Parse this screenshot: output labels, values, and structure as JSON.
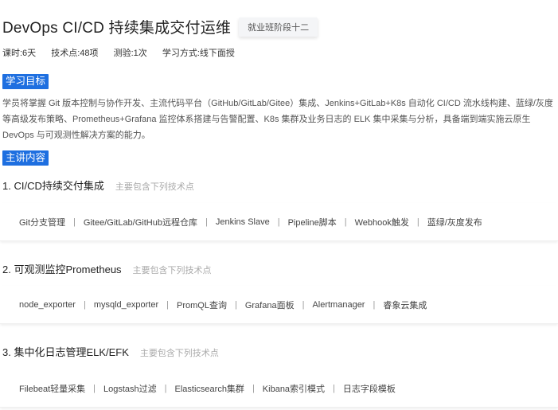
{
  "header": {
    "title": "DevOps CI/CD 持续集成交付运维",
    "stage_badge": "就业班阶段十二"
  },
  "meta": {
    "hours": "课时:6天",
    "points": "技术点:48项",
    "tests": "测验:1次",
    "mode": "学习方式:线下面授"
  },
  "goal": {
    "label": "学习目标",
    "text": "学员将掌握 Git 版本控制与协作开发、主流代码平台（GitHub/GitLab/Gitee）集成、Jenkins+GitLab+K8s 自动化 CI/CD 流水线构建、蓝绿/灰度等高级发布策略、Prometheus+Grafana 监控体系搭建与告警配置、K8s 集群及业务日志的 ELK 集中采集与分析，具备端到端实施云原生 DevOps 与可观测性解决方案的能力。"
  },
  "main": {
    "label": "主讲内容",
    "hint": "主要包含下列技术点",
    "modules": [
      {
        "title": "1. CI/CD持续交付集成",
        "points": [
          "Git分支管理",
          "Gitee/GitLab/GitHub远程仓库",
          "Jenkins Slave",
          "Pipeline脚本",
          "Webhook触发",
          "蓝绿/灰度发布"
        ]
      },
      {
        "title": "2. 可观测监控Prometheus",
        "points": [
          "node_exporter",
          "mysqld_exporter",
          "PromQL查询",
          "Grafana面板",
          "Alertmanager",
          "睿象云集成"
        ]
      },
      {
        "title": "3. 集中化日志管理ELK/EFK",
        "points": [
          "Filebeat轻量采集",
          "Logstash过滤",
          "Elasticsearch集群",
          "Kibana索引模式",
          "日志字段模板"
        ]
      }
    ]
  }
}
